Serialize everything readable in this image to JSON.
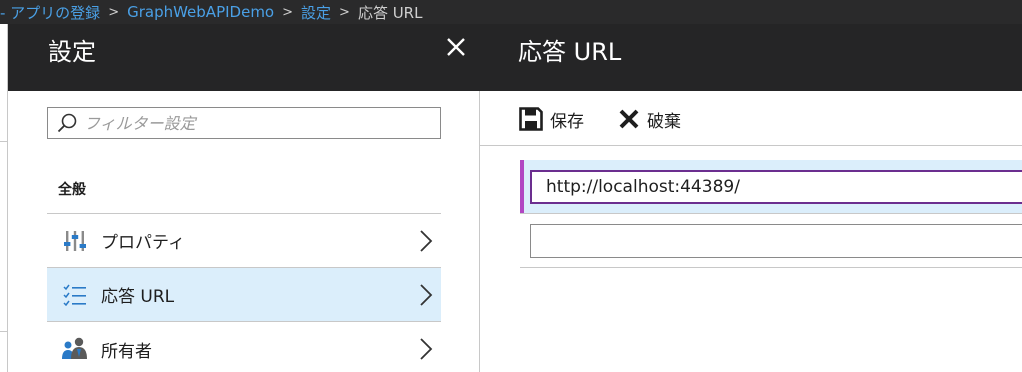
{
  "breadcrumb": {
    "items": [
      "- アプリの登録",
      "GraphWebAPIDemo",
      "設定"
    ],
    "current": "応答 URL",
    "separator": ">"
  },
  "settings_blade": {
    "title": "設定",
    "close_icon": "close-icon",
    "filter_placeholder": "フィルター設定",
    "section_label": "全般",
    "items": [
      {
        "label": "プロパティ",
        "icon": "properties-icon",
        "selected": false
      },
      {
        "label": "応答 URL",
        "icon": "list-check-icon",
        "selected": true
      },
      {
        "label": "所有者",
        "icon": "owners-icon",
        "selected": false
      }
    ]
  },
  "reply_url_blade": {
    "title": "応答 URL",
    "save_label": "保存",
    "discard_label": "破棄",
    "urls": [
      {
        "value": "http://localhost:44389/",
        "active": true
      },
      {
        "value": "",
        "active": false
      }
    ]
  },
  "colors": {
    "header_bg": "#252526",
    "breadcrumb_link": "#4aa0e6",
    "selected_bg": "#dbeefb",
    "active_accent": "#b146c2",
    "active_border": "#6b2e8f",
    "icon_blue": "#2a7ac7"
  }
}
